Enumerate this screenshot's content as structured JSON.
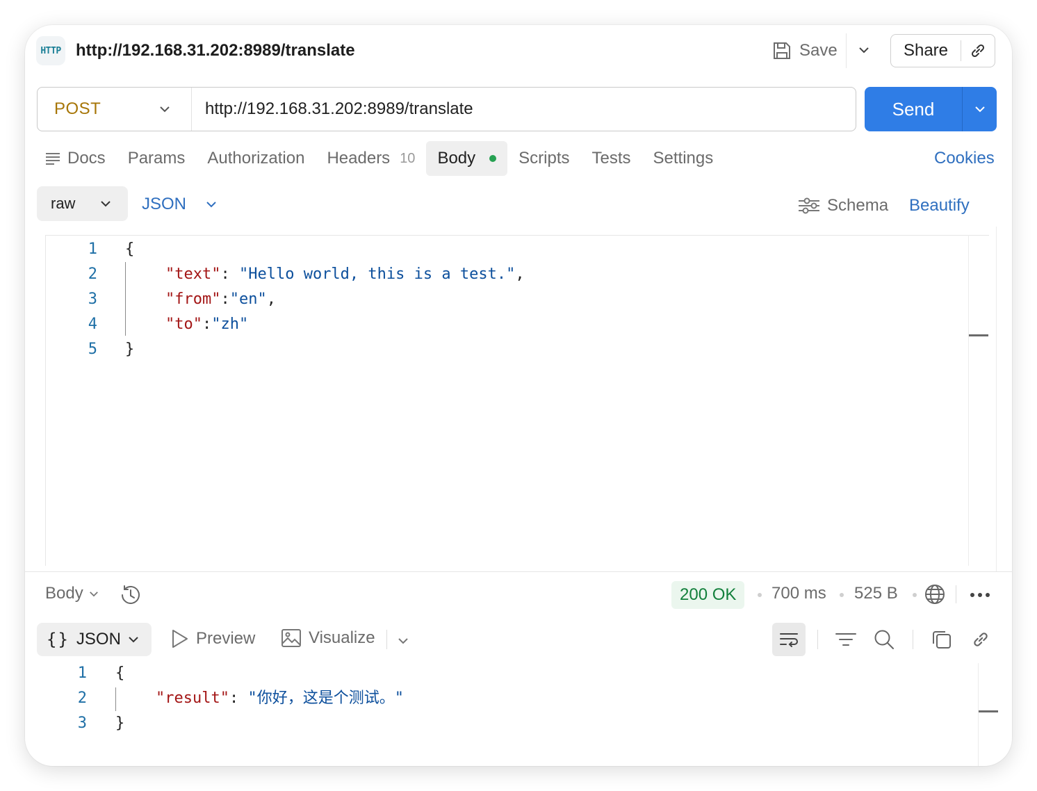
{
  "header": {
    "badge": "HTTP",
    "title": "http://192.168.31.202:8989/translate",
    "save_label": "Save",
    "share_label": "Share"
  },
  "request": {
    "method": "POST",
    "url": "http://192.168.31.202:8989/translate",
    "send_label": "Send"
  },
  "tabs": {
    "docs": "Docs",
    "params": "Params",
    "authorization": "Authorization",
    "headers": "Headers",
    "headers_count": "10",
    "body": "Body",
    "scripts": "Scripts",
    "tests": "Tests",
    "settings": "Settings",
    "active": "Body",
    "cookies": "Cookies"
  },
  "body_options": {
    "mode": "raw",
    "language": "JSON",
    "schema_label": "Schema",
    "beautify_label": "Beautify"
  },
  "request_body": {
    "line_numbers": [
      "1",
      "2",
      "3",
      "4",
      "5"
    ],
    "open_brace": "{",
    "close_brace": "}",
    "text_key": "\"text\"",
    "text_value": "\"Hello world, this is a test.\"",
    "from_key": "\"from\"",
    "from_value": "\"en\"",
    "to_key": "\"to\"",
    "to_value": "\"zh\""
  },
  "response": {
    "section_label": "Body",
    "status": "200 OK",
    "time": "700 ms",
    "size": "525 B",
    "format": "JSON",
    "format_braces": "{}",
    "preview_label": "Preview",
    "visualize_label": "Visualize",
    "line_numbers": [
      "1",
      "2",
      "3"
    ],
    "open_brace": "{",
    "close_brace": "}",
    "result_key": "\"result\"",
    "result_value": "\"你好，这是个测试。\""
  },
  "colors": {
    "accent": "#2f7de6",
    "method": "#a77608",
    "status_ok": "#13803c",
    "json_key": "#a31515",
    "json_string": "#0c4f9c",
    "link": "#2f6fbf"
  },
  "icons": [
    "http-icon",
    "save-icon",
    "chevron-down-icon",
    "link-icon",
    "docs-icon",
    "sliders-icon",
    "history-icon",
    "globe-icon",
    "more-icon",
    "play-icon",
    "image-icon",
    "wrap-icon",
    "filter-icon",
    "search-icon",
    "copy-icon"
  ]
}
